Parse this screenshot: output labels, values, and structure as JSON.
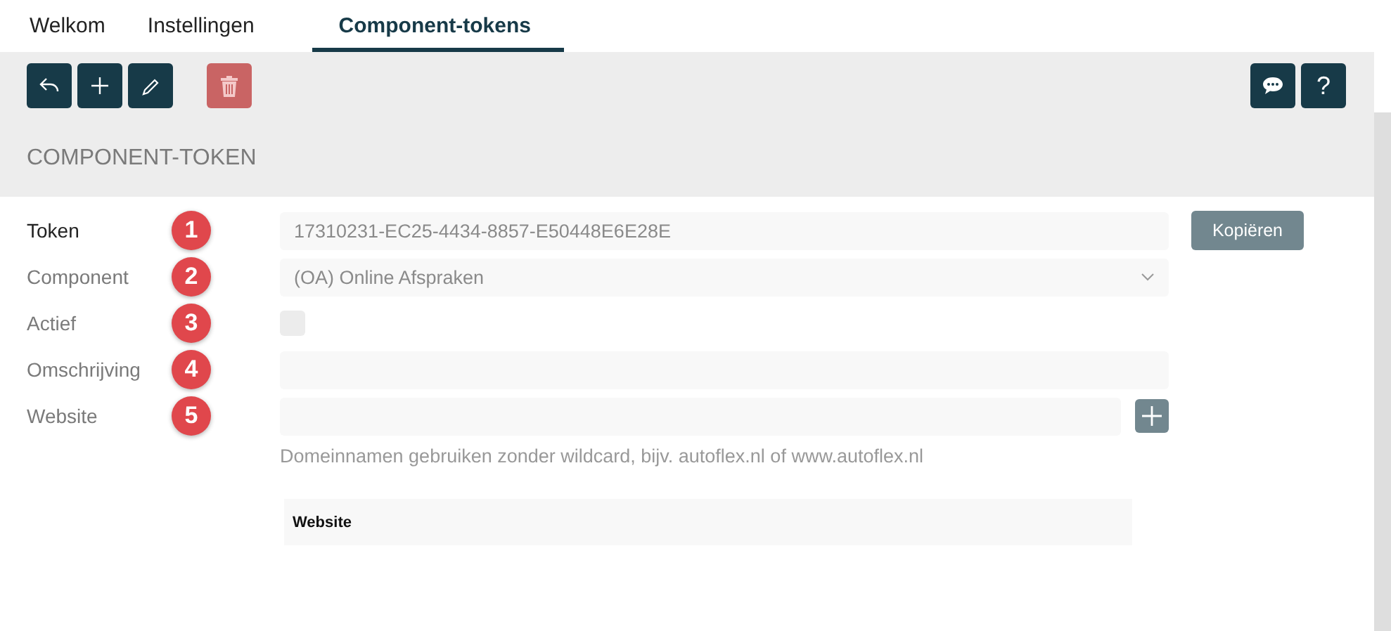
{
  "tabs": [
    {
      "label": "Welkom",
      "selected": false
    },
    {
      "label": "Instellingen",
      "selected": false
    },
    {
      "label": "Component-tokens",
      "selected": true
    }
  ],
  "toolbar": {
    "left": [
      {
        "kind": "back"
      },
      {
        "kind": "add"
      },
      {
        "kind": "edit"
      },
      {
        "kind": "delete"
      }
    ],
    "right": [
      {
        "kind": "chat"
      },
      {
        "kind": "help",
        "label": "?"
      }
    ]
  },
  "section_title": "COMPONENT-TOKEN",
  "form": {
    "fields": [
      {
        "kind": "text",
        "label": "Token",
        "emphasized": true,
        "badge": "1",
        "value": "17310231-EC25-4434-8857-E50448E6E28E",
        "action": "Kopiëren"
      },
      {
        "kind": "select",
        "label": "Component",
        "emphasized": false,
        "badge": "2",
        "value": "(OA) Online Afspraken"
      },
      {
        "kind": "checkbox",
        "label": "Actief",
        "emphasized": false,
        "badge": "3",
        "checked": false
      },
      {
        "kind": "text",
        "label": "Omschrijving",
        "emphasized": false,
        "badge": "4"
      },
      {
        "kind": "text",
        "label": "Website",
        "emphasized": false,
        "badge": "5",
        "add_button": true
      }
    ],
    "hint": "Domeinnamen gebruiken zonder wildcard, bijv. autoflex.nl of www.autoflex.nl",
    "table": {
      "columns": [
        "Website"
      ]
    }
  }
}
